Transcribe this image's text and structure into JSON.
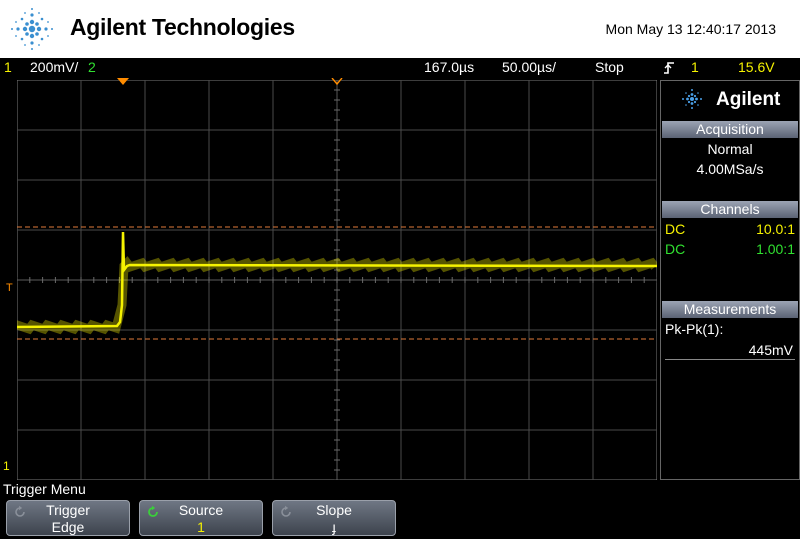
{
  "header": {
    "brand": "Agilent Technologies",
    "datetime": "Mon May 13 12:40:17 2013"
  },
  "status": {
    "ch1_num": "1",
    "ch1_scale": "200mV/",
    "ch2_num": "2",
    "time_delay": "167.0µs",
    "time_scale": "50.00µs/",
    "run_state": "Stop",
    "trigger_source": "1",
    "trigger_level": "15.6V"
  },
  "side": {
    "brand": "Agilent",
    "acquisition": {
      "title": "Acquisition",
      "mode": "Normal",
      "rate": "4.00MSa/s"
    },
    "channels": {
      "title": "Channels",
      "rows": [
        {
          "coupling": "DC",
          "probe": "10.0:1"
        },
        {
          "coupling": "DC",
          "probe": "1.00:1"
        }
      ]
    },
    "measurements": {
      "title": "Measurements",
      "items": [
        {
          "name": "Pk-Pk(1):",
          "value": "445mV"
        }
      ]
    }
  },
  "markers": {
    "trigger_level_marker": "T",
    "ground_marker": "1"
  },
  "menu": {
    "title": "Trigger Menu",
    "softkeys": [
      {
        "label": "Trigger",
        "value": "Edge"
      },
      {
        "label": "Source",
        "value": "1"
      },
      {
        "label": "Slope",
        "value": "ɟ"
      }
    ]
  },
  "colors": {
    "ch1": "#f5f200",
    "ch2": "#30e030",
    "grid": "#4a4a4a",
    "cursor": "#e07a3a",
    "trigger": "#ff8c00"
  },
  "icons": {
    "logo": "agilent-spark-icon",
    "trigger_slope": "rising-edge-icon",
    "softkey": "rotate-icon"
  }
}
